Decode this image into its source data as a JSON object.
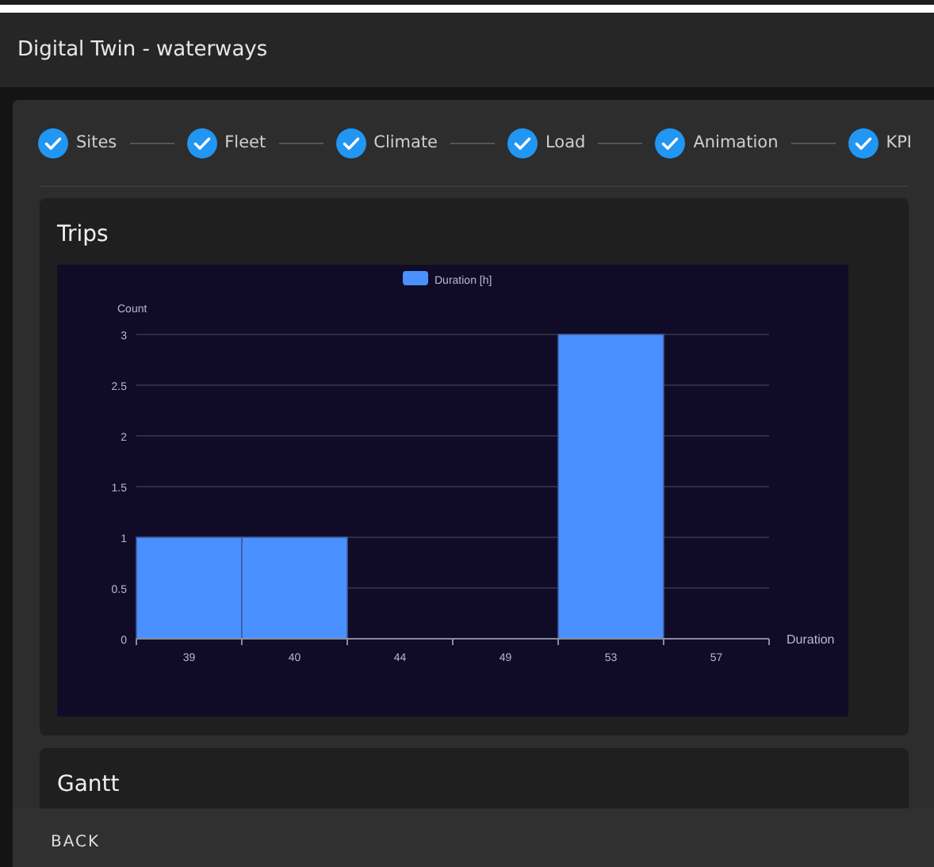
{
  "window": {
    "title": "Digital Twin - waterways"
  },
  "steps": [
    {
      "label": "Sites",
      "completed": true
    },
    {
      "label": "Fleet",
      "completed": true
    },
    {
      "label": "Climate",
      "completed": true
    },
    {
      "label": "Load",
      "completed": true
    },
    {
      "label": "Animation",
      "completed": true
    },
    {
      "label": "KPI",
      "completed": true
    }
  ],
  "sections": [
    {
      "title": "Trips",
      "chart_data": {
        "type": "bar",
        "xlabel": "Duration",
        "ylabel": "Count",
        "categories": [
          "39",
          "40",
          "44",
          "49",
          "53",
          "57"
        ],
        "series": [
          {
            "name": "Duration [h]",
            "color": "#4a90ff",
            "values": [
              1,
              1,
              0,
              0,
              3,
              0
            ]
          }
        ],
        "grid": true,
        "ylim": [
          0,
          3
        ],
        "yticks": [
          0,
          0.5,
          1,
          1.5,
          2,
          2.5,
          3
        ]
      }
    },
    {
      "title": "Gantt"
    }
  ],
  "footer": {
    "back_button": "BACK"
  }
}
